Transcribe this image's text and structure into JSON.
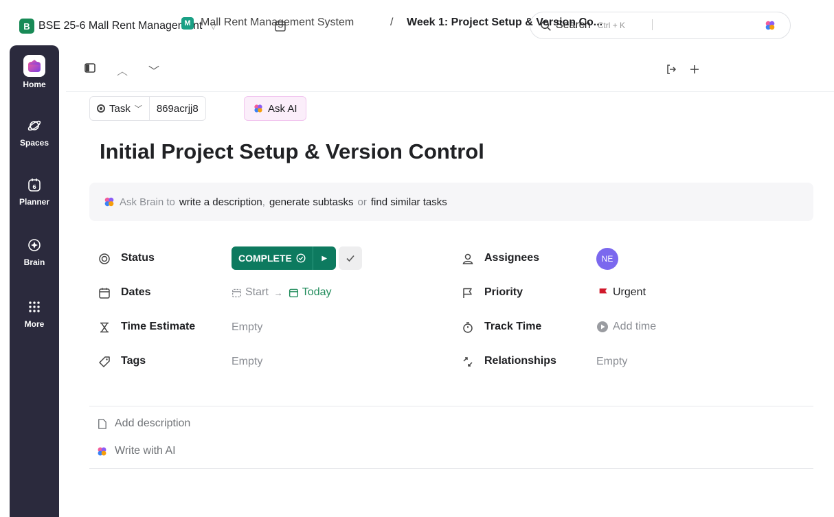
{
  "workspace": {
    "badge": "B",
    "name": "BSE 25-6 Mall Rent Management"
  },
  "search": {
    "label": "Search",
    "shortcut": "Ctrl + K"
  },
  "nav": {
    "items": [
      {
        "label": "Home"
      },
      {
        "label": "Spaces"
      },
      {
        "label": "Planner"
      },
      {
        "label": "Brain"
      },
      {
        "label": "More"
      }
    ]
  },
  "breadcrumb": {
    "space_badge": "M",
    "space": "Mall Rent Management System",
    "separator": "/",
    "current": "Week 1: Project Setup & Version Co..."
  },
  "task": {
    "type_label": "Task",
    "id": "869acrjj8",
    "ask_ai": "Ask AI",
    "title": "Initial Project Setup & Version Control"
  },
  "brain_prompt": {
    "prefix": "Ask Brain to",
    "action1": "write a description",
    "sep1": ",",
    "action2": "generate subtasks",
    "or": "or",
    "action3": "find similar tasks"
  },
  "fields": {
    "status": {
      "label": "Status",
      "value": "COMPLETE"
    },
    "dates": {
      "label": "Dates",
      "start": "Start",
      "arrow": "→",
      "end": "Today"
    },
    "time_estimate": {
      "label": "Time Estimate",
      "value": "Empty"
    },
    "tags": {
      "label": "Tags",
      "value": "Empty"
    },
    "assignees": {
      "label": "Assignees",
      "initials": "NE"
    },
    "priority": {
      "label": "Priority",
      "value": "Urgent"
    },
    "track_time": {
      "label": "Track Time",
      "value": "Add time"
    },
    "relationships": {
      "label": "Relationships",
      "value": "Empty"
    }
  },
  "description": {
    "add": "Add description",
    "write_ai": "Write with AI"
  },
  "colors": {
    "status_complete": "#0d7a5f",
    "nav_bg": "#2b2a3d",
    "priority_urgent": "#d0192b",
    "date_today": "#1f8b5a",
    "avatar": "#7b68ee"
  }
}
